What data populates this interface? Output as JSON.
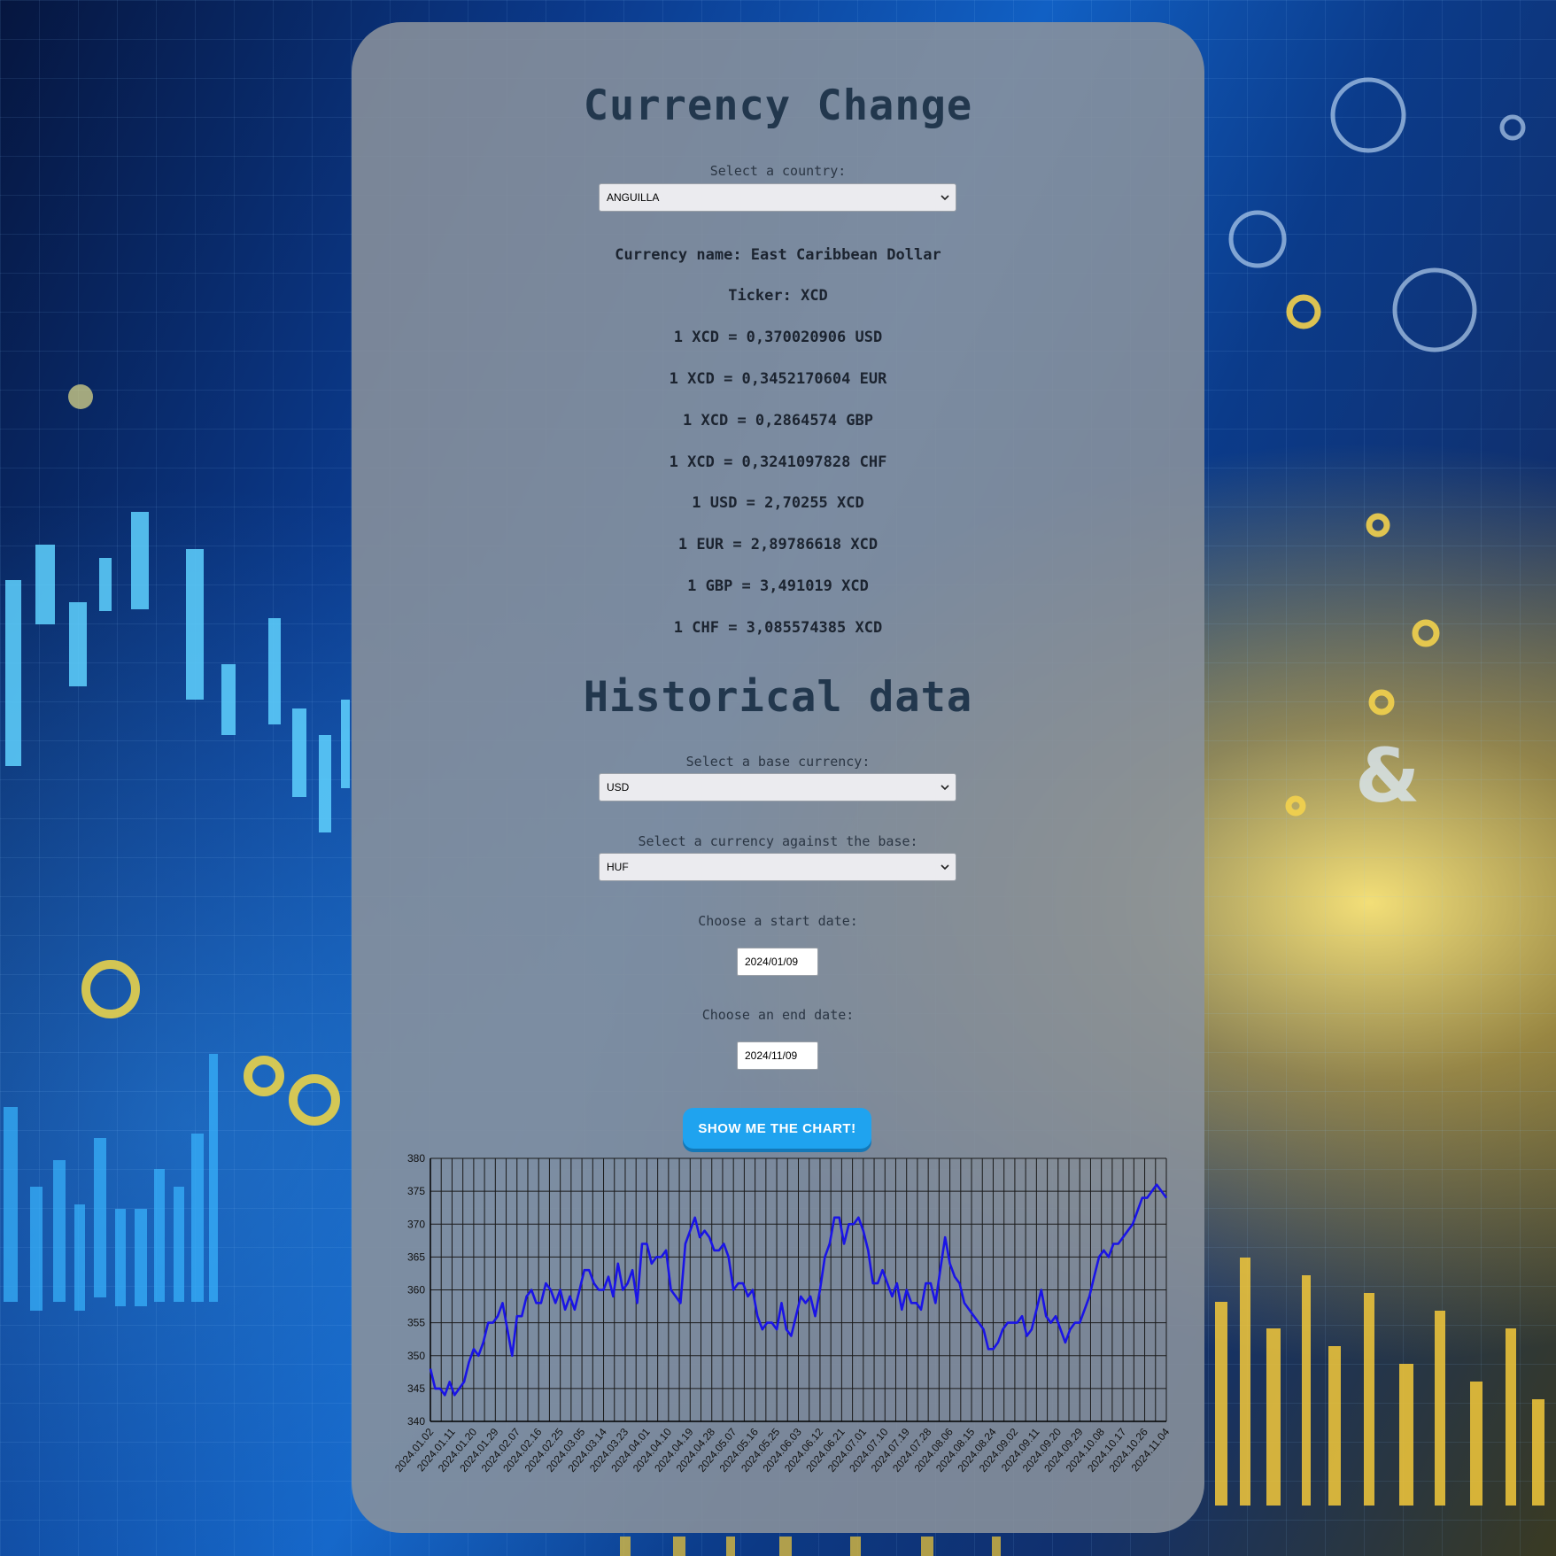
{
  "header": {
    "title": "Currency Change"
  },
  "country": {
    "label": "Select a country:",
    "selected": "ANGUILLA"
  },
  "currency_info": {
    "name": "Currency name: East Caribbean Dollar",
    "ticker": "Ticker: XCD",
    "rates": [
      "1 XCD = 0,370020906 USD",
      "1 XCD = 0,3452170604 EUR",
      "1 XCD = 0,2864574 GBP",
      "1 XCD = 0,3241097828 CHF",
      "1 USD = 2,70255 XCD",
      "1 EUR = 2,89786618 XCD",
      "1 GBP = 3,491019 XCD",
      "1 CHF = 3,085574385 XCD"
    ]
  },
  "historical": {
    "title": "Historical data",
    "base_label": "Select a base currency:",
    "base_selected": "USD",
    "against_label": "Select a currency against the base:",
    "against_selected": "HUF",
    "start_label": "Choose a start date:",
    "start_value": "2024/01/09",
    "end_label": "Choose an end date:",
    "end_value": "2024/11/09",
    "button_label": "SHOW ME THE CHART!"
  },
  "colors": {
    "accent": "#1fa3ef",
    "line": "#1a14e6",
    "title": "#22374d"
  },
  "chart_data": {
    "type": "line",
    "title": "",
    "xlabel": "",
    "ylabel": "",
    "ylim": [
      340,
      380
    ],
    "yticks": [
      340,
      345,
      350,
      355,
      360,
      365,
      370,
      375,
      380
    ],
    "grid": true,
    "xticks": [
      "2024.01.02",
      "2024.01.11",
      "2024.01.20",
      "2024.01.29",
      "2024.02.07",
      "2024.02.16",
      "2024.02.25",
      "2024.03.05",
      "2024.03.14",
      "2024.03.23",
      "2024.04.01",
      "2024.04.10",
      "2024.04.19",
      "2024.04.28",
      "2024.05.07",
      "2024.05.16",
      "2024.05.25",
      "2024.06.03",
      "2024.06.12",
      "2024.06.21",
      "2024.07.01",
      "2024.07.10",
      "2024.07.19",
      "2024.07.28",
      "2024.08.06",
      "2024.08.15",
      "2024.08.24",
      "2024.09.02",
      "2024.09.11",
      "2024.09.20",
      "2024.09.29",
      "2024.10.08",
      "2024.10.17",
      "2024.10.26",
      "2024.11.04"
    ],
    "series": [
      {
        "values": [
          348,
          345,
          345,
          344,
          346,
          344,
          345,
          346,
          349,
          351,
          350,
          352,
          355,
          355,
          356,
          358,
          354,
          350,
          356,
          356,
          359,
          360,
          358,
          358,
          361,
          360,
          358,
          360,
          357,
          359,
          357,
          360,
          363,
          363,
          361,
          360,
          360,
          362,
          359,
          364,
          360,
          361,
          363,
          358,
          367,
          367,
          364,
          365,
          365,
          366,
          360,
          359,
          358,
          367,
          369,
          371,
          368,
          369,
          368,
          366,
          366,
          367,
          365,
          360,
          361,
          361,
          359,
          360,
          356,
          354,
          355,
          355,
          354,
          358,
          354,
          353,
          356,
          359,
          358,
          359,
          356,
          360,
          365,
          367,
          371,
          371,
          367,
          370,
          370,
          371,
          369,
          366,
          361,
          361,
          363,
          361,
          359,
          361,
          357,
          360,
          358,
          358,
          357,
          361,
          361,
          358,
          363,
          368,
          364,
          362,
          361,
          358,
          357,
          356,
          355,
          354,
          351,
          351,
          352,
          354,
          355,
          355,
          355,
          356,
          353,
          354,
          357,
          360,
          356,
          355,
          356,
          354,
          352,
          354,
          355,
          355,
          357,
          359,
          362,
          365,
          366,
          365,
          367,
          367,
          368,
          369,
          370,
          372,
          374,
          374,
          375,
          376,
          375,
          374
        ]
      }
    ]
  }
}
